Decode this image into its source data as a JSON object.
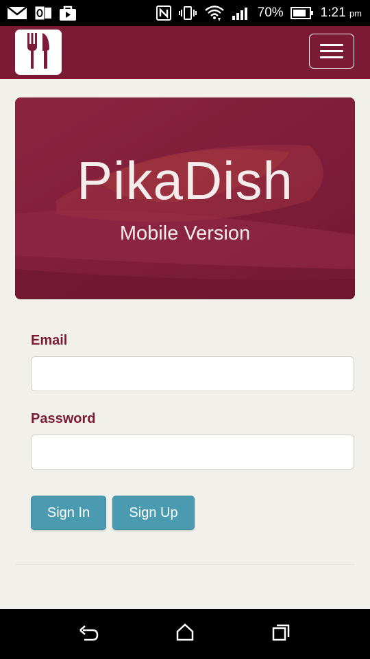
{
  "status_bar": {
    "icons_left": [
      "mail-icon",
      "outlook-icon",
      "bag-icon"
    ],
    "icons_right": [
      "nfc-icon",
      "vibrate-icon",
      "wifi-icon",
      "signal-icon"
    ],
    "battery_text": "70%",
    "time": "1:21",
    "time_suffix": "pm"
  },
  "app_bar": {
    "logo_icon": "fork-knife-icon",
    "menu_icon": "hamburger-menu-icon"
  },
  "hero": {
    "title": "PikaDish",
    "subtitle": "Mobile Version"
  },
  "form": {
    "email_label": "Email",
    "email_value": "",
    "password_label": "Password",
    "password_value": "",
    "sign_in_label": "Sign In",
    "sign_up_label": "Sign Up"
  },
  "nav_bar": {
    "back_icon": "back-icon",
    "home_icon": "home-icon",
    "recents_icon": "recents-icon"
  },
  "colors": {
    "brand": "#7a1a34",
    "hero": "#7f1c39",
    "button": "#4a9bb0",
    "background": "#f2f0ea"
  }
}
